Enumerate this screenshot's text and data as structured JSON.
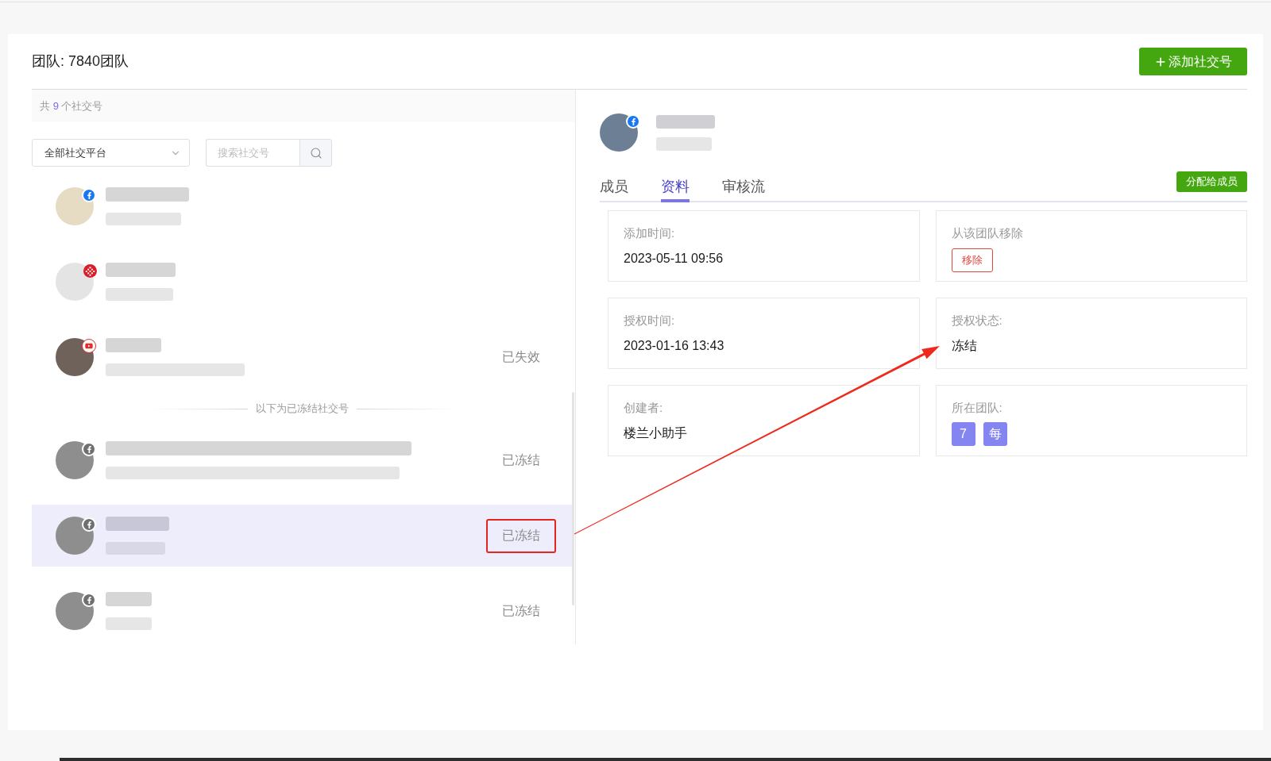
{
  "header": {
    "title": "团队: 7840团队",
    "add_button": "添加社交号"
  },
  "account_list": {
    "count_prefix": "共",
    "count": "9",
    "count_suffix": "个社交号",
    "platform_filter": "全部社交平台",
    "search": {
      "placeholder": "搜索社交号"
    },
    "items": [
      {
        "kind": "account",
        "badge": {
          "kind": "facebook"
        },
        "frozen": false,
        "selected": false,
        "annotated": false
      },
      {
        "kind": "account",
        "badge": {
          "kind": "dotted"
        },
        "frozen": false,
        "selected": false,
        "annotated": false
      },
      {
        "kind": "account",
        "badge": {
          "kind": "youtube"
        },
        "frozen": false,
        "selected": false,
        "annotated": false,
        "status": "已失效"
      },
      {
        "kind": "divider",
        "label": "以下为已冻结社交号"
      },
      {
        "kind": "account",
        "badge": {
          "kind": "facebook"
        },
        "frozen": true,
        "selected": false,
        "annotated": false,
        "status": "已冻结"
      },
      {
        "kind": "account",
        "badge": {
          "kind": "facebook"
        },
        "frozen": true,
        "selected": true,
        "annotated": true,
        "status": "已冻结"
      },
      {
        "kind": "account",
        "badge": {
          "kind": "facebook"
        },
        "frozen": true,
        "selected": false,
        "annotated": false,
        "status": "已冻结"
      }
    ]
  },
  "detail": {
    "badge": {
      "kind": "facebook"
    },
    "tabs": [
      {
        "label": "成员",
        "selected": false
      },
      {
        "label": "资料",
        "selected": true
      },
      {
        "label": "审核流",
        "selected": false
      }
    ],
    "assign_button": "分配给成员",
    "fields": [
      {
        "kind": "text",
        "label": "添加时间:",
        "value": "2023-05-11 09:56"
      },
      {
        "kind": "action",
        "label": "从该团队移除",
        "button": "移除"
      },
      {
        "kind": "text",
        "label": "授权时间:",
        "value": "2023-01-16 13:43"
      },
      {
        "kind": "text",
        "label": "授权状态:",
        "value": "冻结"
      },
      {
        "kind": "text",
        "label": "创建者:",
        "value": "楼兰小助手"
      },
      {
        "kind": "tags",
        "label": "所在团队:",
        "tags": [
          "7",
          "每"
        ]
      }
    ]
  }
}
